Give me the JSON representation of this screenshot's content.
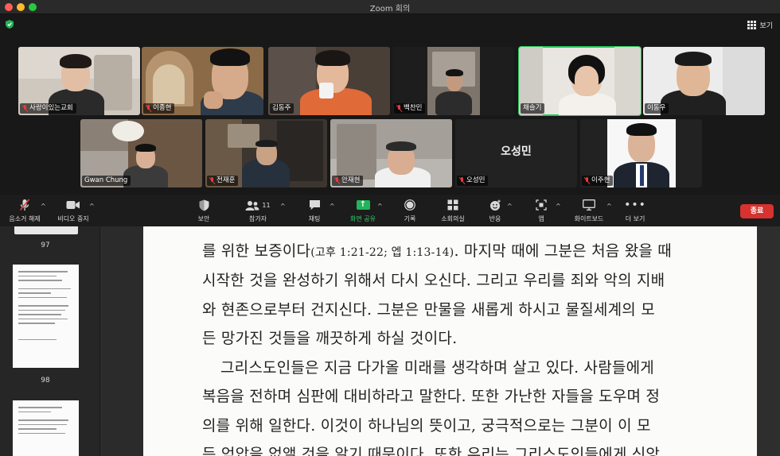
{
  "window": {
    "title": "Zoom 회의"
  },
  "header": {
    "view_label": "보기"
  },
  "participants": [
    {
      "name": "사랑이있는교회",
      "muted": true
    },
    {
      "name": "이종현",
      "muted": true
    },
    {
      "name": "김동주",
      "muted": false
    },
    {
      "name": "백찬민",
      "muted": true
    },
    {
      "name": "채슬기",
      "muted": false,
      "speaking": true
    },
    {
      "name": "이동우",
      "muted": false
    },
    {
      "name": "Gwan Chung",
      "muted": false
    },
    {
      "name": "전재훈",
      "muted": true
    },
    {
      "name": "안재현",
      "muted": true
    },
    {
      "name": "오성민",
      "muted": true,
      "video_off": true
    },
    {
      "name": "이주현",
      "muted": true
    }
  ],
  "toolbar": {
    "unmute": "음소거 해제",
    "video": "비디오 중지",
    "security": "보안",
    "participants": "참가자",
    "participants_count": "11",
    "chat": "채팅",
    "share": "화면 공유",
    "record": "기록",
    "breakout": "소회의실",
    "reactions": "반응",
    "apps": "앱",
    "whiteboard": "화이트보드",
    "more": "더 보기",
    "end": "종료"
  },
  "pdf": {
    "page_numbers": [
      "97",
      "98"
    ],
    "lines": [
      {
        "text": "를 위한 보증이다",
        "ref": "(고후 1:21-22; 엡 1:13-14)",
        "rest": ". 마지막 때에 그분은 처음 왔을 때"
      },
      {
        "text": "시작한 것을 완성하기 위해서 다시 오신다. 그리고 우리를 죄와 악의 지배"
      },
      {
        "text": "와 현존으로부터 건지신다. 그분은 만물을 새롭게 하시고 물질세계의 모"
      },
      {
        "text": "든 망가진 것들을 깨끗하게 하실 것이다."
      },
      {
        "text": "그리스도인들은 지금 다가올 미래를 생각하며 살고 있다. 사람들에게"
      },
      {
        "text": "복음을 전하며 심판에 대비하라고 말한다. 또한 가난한 자들을 도우며 정"
      },
      {
        "text": "의를 위해 일한다. 이것이 하나님의 뜻이고, 궁극적으로는 그분이 이 모"
      },
      {
        "text": "든 억압을 없앨 것을 알기 때문이다. 또한 우리는 그리스도인들에게 신앙"
      }
    ]
  },
  "colors": {
    "end": "#d6322f",
    "share": "#23b35a",
    "speaking": "#29c45a",
    "muted": "#e23d3d"
  }
}
